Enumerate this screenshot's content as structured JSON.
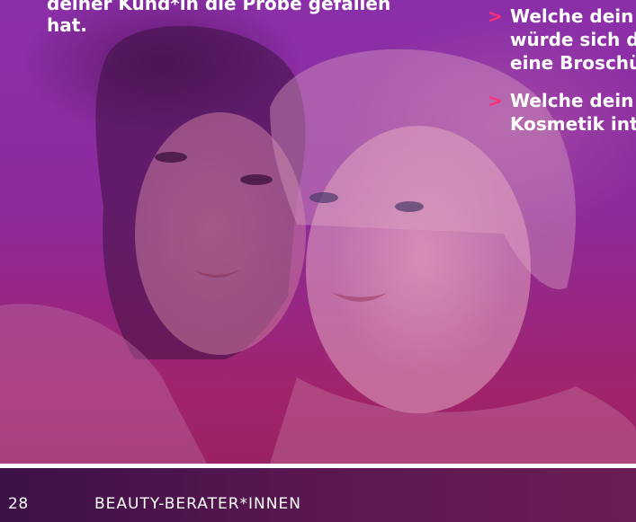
{
  "intro": {
    "lines": [
      "deiner Kund*in die Probe gefallen",
      "hat."
    ]
  },
  "questions": [
    {
      "lines": [
        "Welche dein",
        "würde sich d",
        "eine Broschü"
      ]
    },
    {
      "lines": [
        "Welche dein",
        "Kosmetik int"
      ]
    }
  ],
  "bullet_symbol": ">",
  "footer": {
    "page_number": "28",
    "section_title": "BEAUTY-BERATER*INNEN"
  },
  "colors": {
    "accent": "#ff2e7a",
    "overlay": "#8b2fa9",
    "footer_bg": "#4a1450"
  }
}
